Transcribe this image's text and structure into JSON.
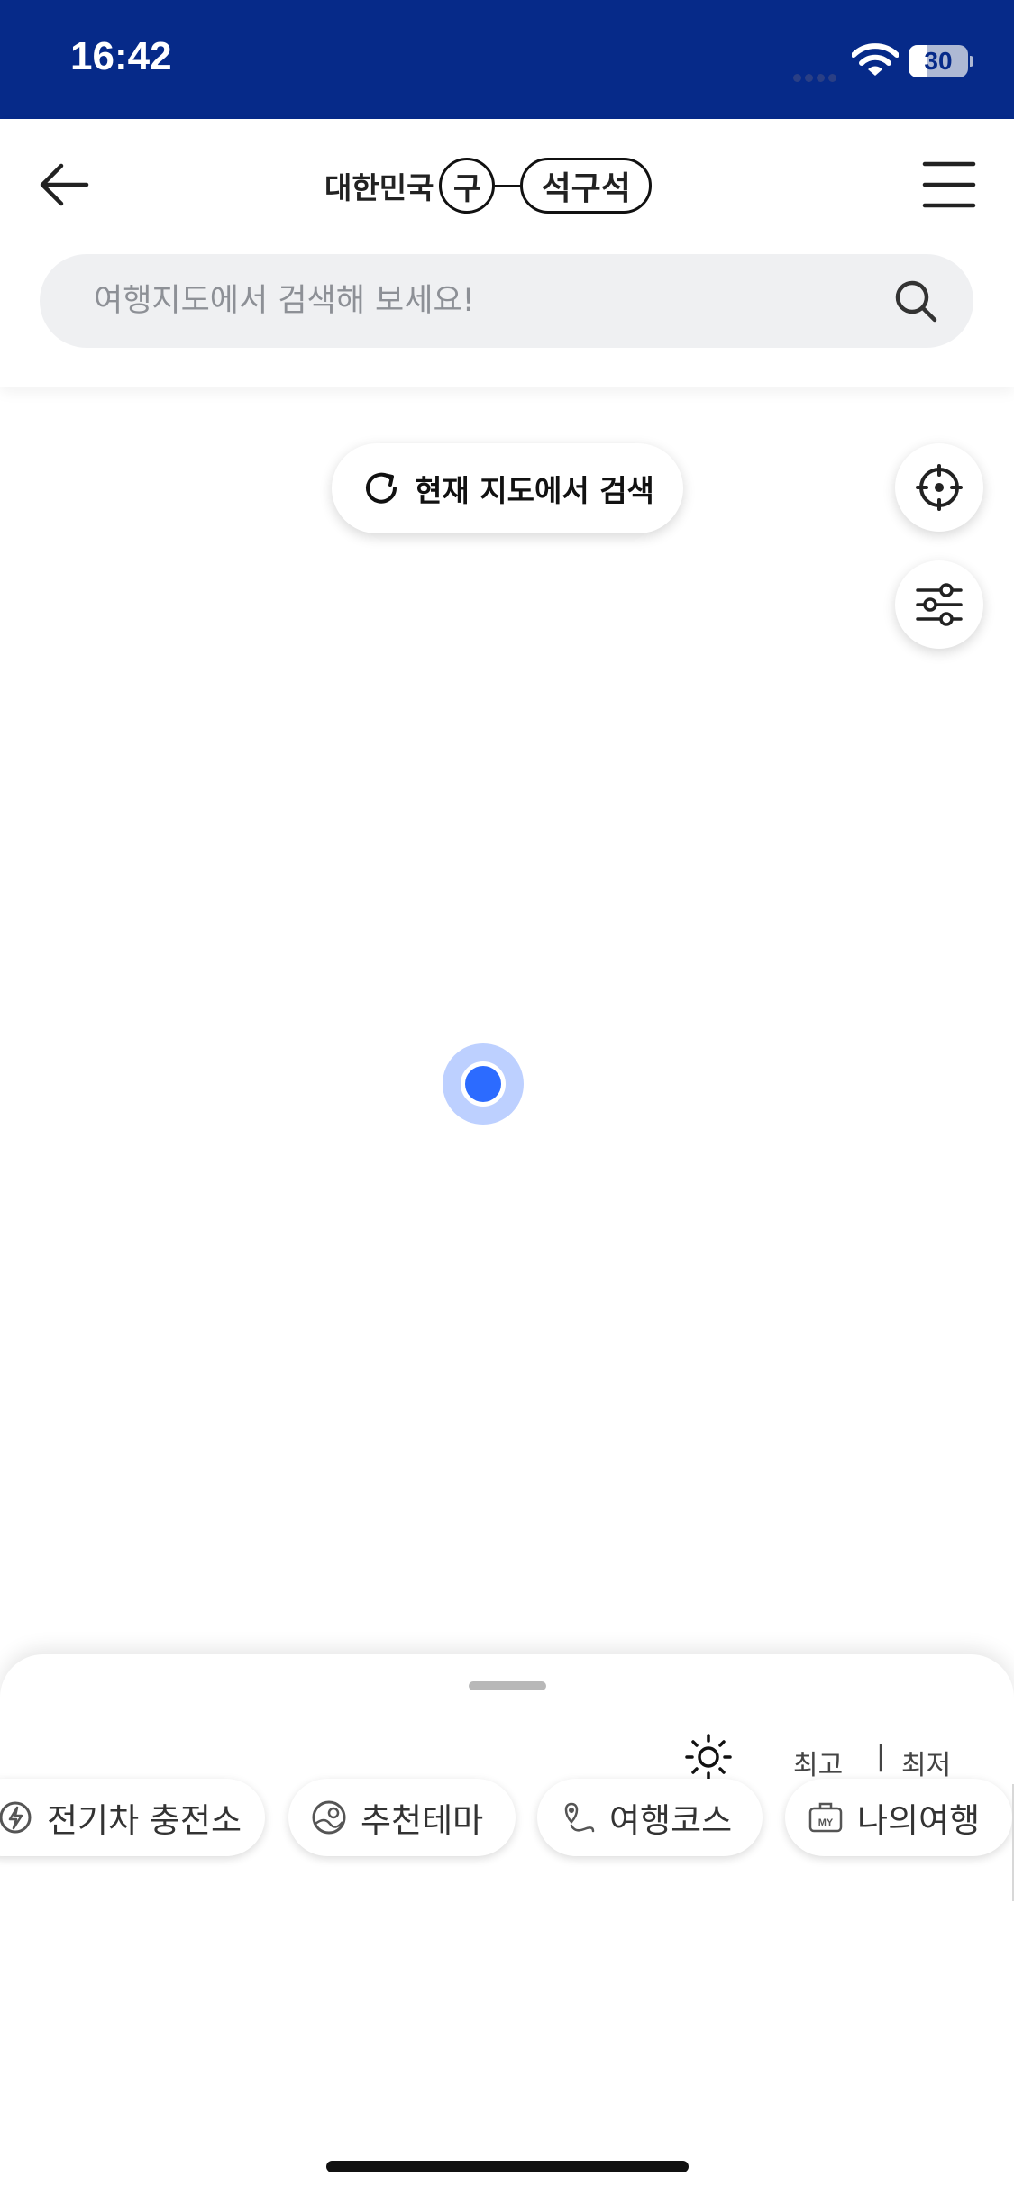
{
  "status_bar": {
    "time": "16:42",
    "battery": "30",
    "battery_level": 0.3,
    "wifi_icon": "wifi-icon"
  },
  "header": {
    "logo": {
      "text": "대한민국",
      "circle_char": "구",
      "pill_text": "석구석"
    },
    "back_icon": "arrow-left-icon",
    "menu_icon": "hamburger-menu-icon"
  },
  "search": {
    "placeholder": "여행지도에서 검색해 보세요!",
    "value": "",
    "icon": "search-icon"
  },
  "map": {
    "refresh_label": "현재 지도에서 검색",
    "locate_icon": "crosshair-icon",
    "filter_icon": "sliders-icon"
  },
  "bottom_sheet": {
    "weather_icon": "sun-icon",
    "temp_high_label": "최고",
    "temp_separator": "|",
    "temp_low_label": "최저",
    "chips": [
      {
        "label": "전기차 충전소",
        "icon": "ev-charger-icon"
      },
      {
        "label": "추천테마",
        "icon": "theme-map-icon"
      },
      {
        "label": "여행코스",
        "icon": "route-pin-icon"
      },
      {
        "label": "나의여행",
        "icon": "my-suitcase-icon"
      }
    ]
  },
  "colors": {
    "status_bar": "#062a89",
    "location_dot": "#2c6bff",
    "search_bg": "#eff0f2"
  }
}
